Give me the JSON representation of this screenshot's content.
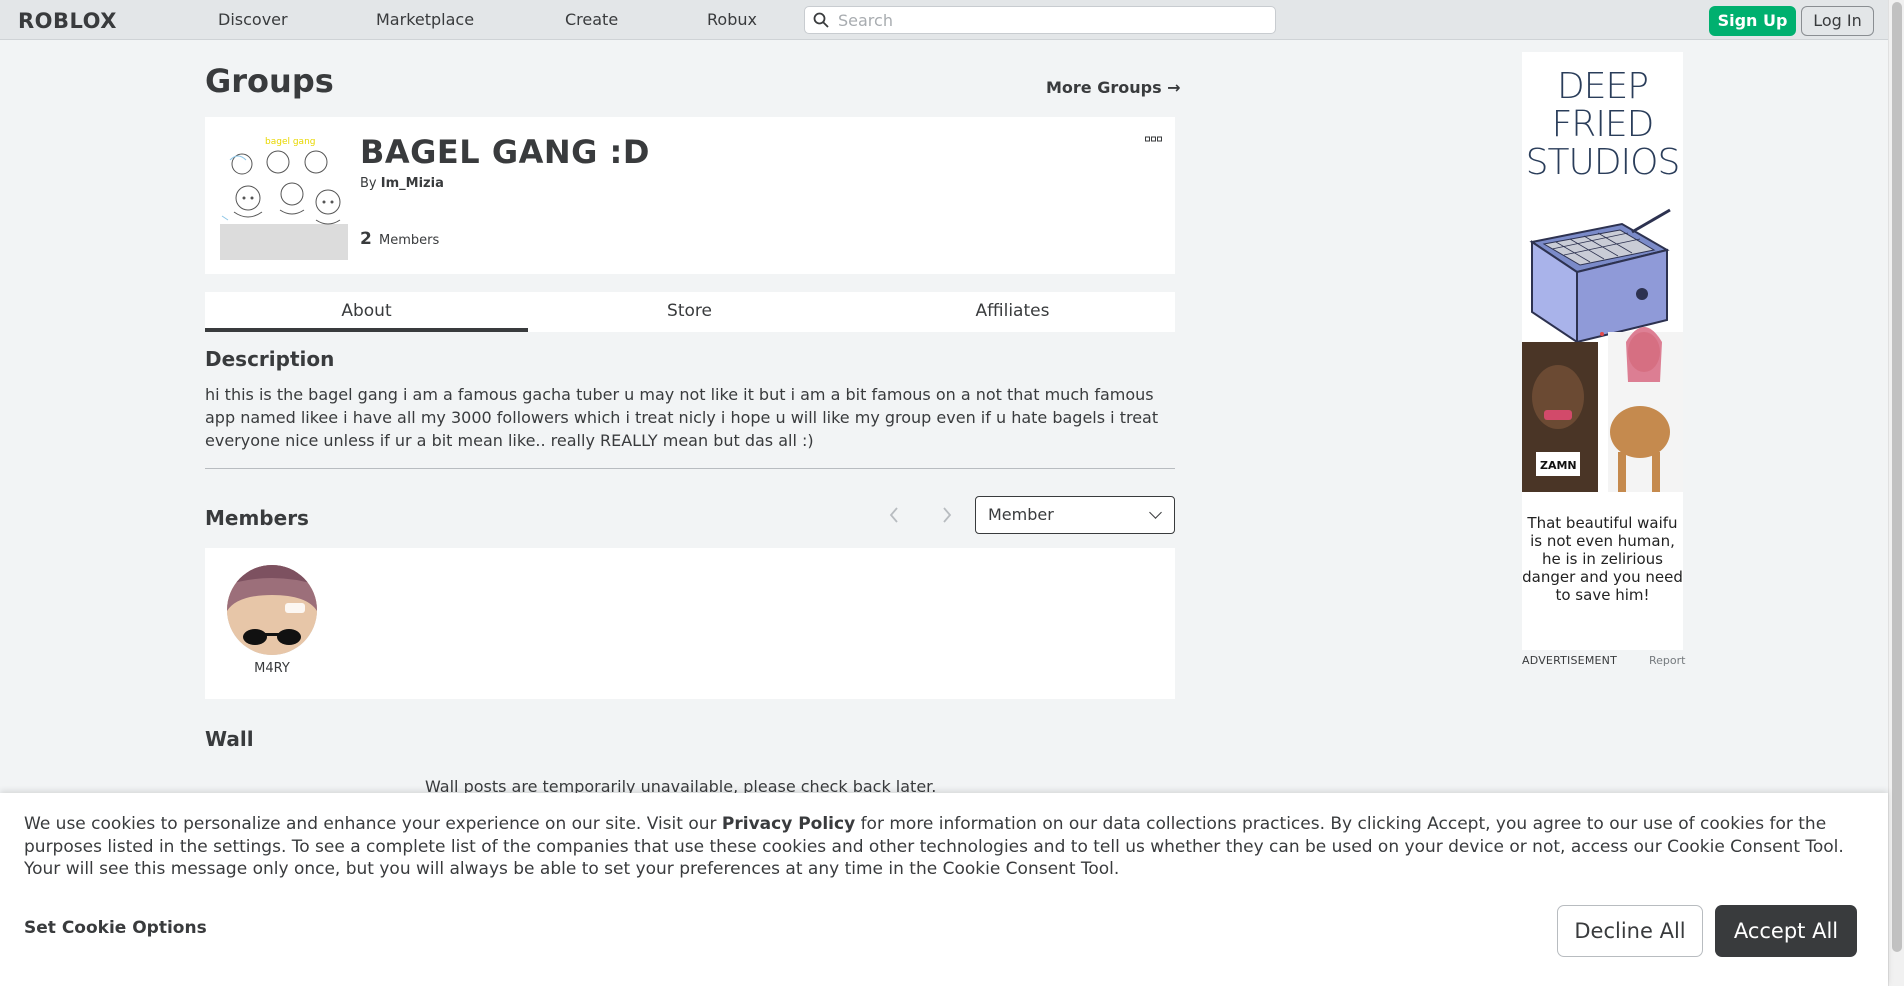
{
  "nav": {
    "logo": "ROBLOX",
    "links": [
      "Discover",
      "Marketplace",
      "Create",
      "Robux"
    ],
    "search_placeholder": "Search",
    "signup_label": "Sign Up",
    "login_label": "Log In"
  },
  "page": {
    "title": "Groups",
    "more_groups_label": "More Groups →"
  },
  "group": {
    "name": "BAGEL GANG :D",
    "by_prefix": "By",
    "owner": "Im_Mizia",
    "member_count": "2",
    "member_count_label": "Members",
    "menu_icon": "more-dots-icon"
  },
  "tabs": [
    "About",
    "Store",
    "Affiliates"
  ],
  "about": {
    "description_heading": "Description",
    "description": "hi this is the bagel gang i am a famous gacha tuber u may not like it but i am a bit famous on a not that much famous app named likee i have all my 3000 followers which i treat nicly i hope u will like my group even if u hate bagels i treat everyone nice unless if ur a bit mean like.. really REALLY mean but das all :)",
    "members_heading": "Members",
    "role_filter_value": "Member",
    "members": [
      {
        "name": "M4RY"
      }
    ],
    "wall_heading": "Wall",
    "wall_message": "Wall posts are temporarily unavailable, please check back later."
  },
  "ad": {
    "title_lines": [
      "DEEP",
      "FRIED",
      "STUDIOS"
    ],
    "caption": "That beautiful waifu is not even human, he is in zelirious danger and you need to save him!",
    "inset_text": "ZAMN",
    "label": "ADVERTISEMENT",
    "report_label": "Report"
  },
  "cookie": {
    "text_before": "We use cookies to personalize and enhance your experience on our site. Visit our ",
    "privacy_link": "Privacy Policy",
    "text_after": " for more information on our data collections practices. By clicking Accept, you agree to our use of cookies for the purposes listed in the settings. To see a complete list of the companies that use these cookies and other technologies and to tell us whether they can be used on your device or not, access our Cookie Consent Tool. Your will see this message only once, but you will always be able to set your preferences at any time in the Cookie Consent Tool.",
    "options_label": "Set Cookie Options",
    "decline_label": "Decline All",
    "accept_label": "Accept All"
  },
  "colors": {
    "primary_green": "#00b06f",
    "text": "#393b3d",
    "background": "#f2f4f5",
    "accept_button": "#393b3d"
  }
}
